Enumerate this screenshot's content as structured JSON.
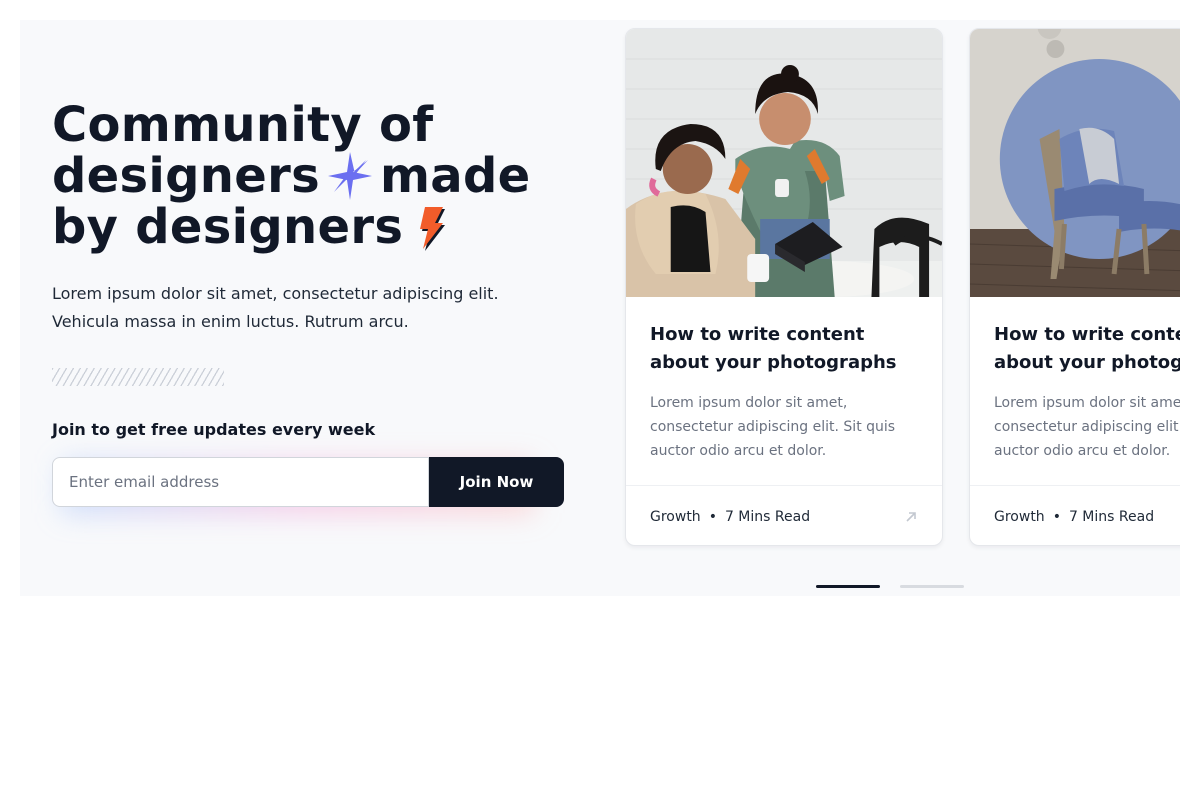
{
  "hero": {
    "headline_line1": "Community of",
    "headline_line2_a": "designers",
    "headline_line2_b": "made",
    "headline_line3": "by designers",
    "description": "Lorem ipsum dolor sit amet, consectetur adipiscing elit. Vehicula massa in enim luctus. Rutrum arcu.",
    "cta_label": "Join to get free updates every week",
    "email_placeholder": "Enter email address",
    "email_value": "",
    "join_button": "Join Now"
  },
  "colors": {
    "accent_purple": "#6b6ff0",
    "accent_orange": "#f25c2a",
    "dark": "#111827"
  },
  "cards": [
    {
      "image": "photo-two-women-laptop",
      "title_line1": "How to write content",
      "title_line2": "about your photographs",
      "excerpt": "Lorem ipsum dolor sit amet, consectetur adipiscing elit. Sit quis auctor odio arcu et dolor.",
      "category": "Growth",
      "separator": "•",
      "read_time": "7 Mins Read",
      "arrow": "arrow-up-right-icon"
    },
    {
      "image": "photo-blue-armchair",
      "title_line1": "How to write content",
      "title_line2": "about your photographs",
      "excerpt": "Lorem ipsum dolor sit amet, consectetur adipiscing elit. Sit quis auctor odio arcu et dolor.",
      "category": "Growth",
      "separator": "•",
      "read_time": "7 Mins Read"
    }
  ],
  "pager": {
    "pages": 2,
    "active": 1
  }
}
